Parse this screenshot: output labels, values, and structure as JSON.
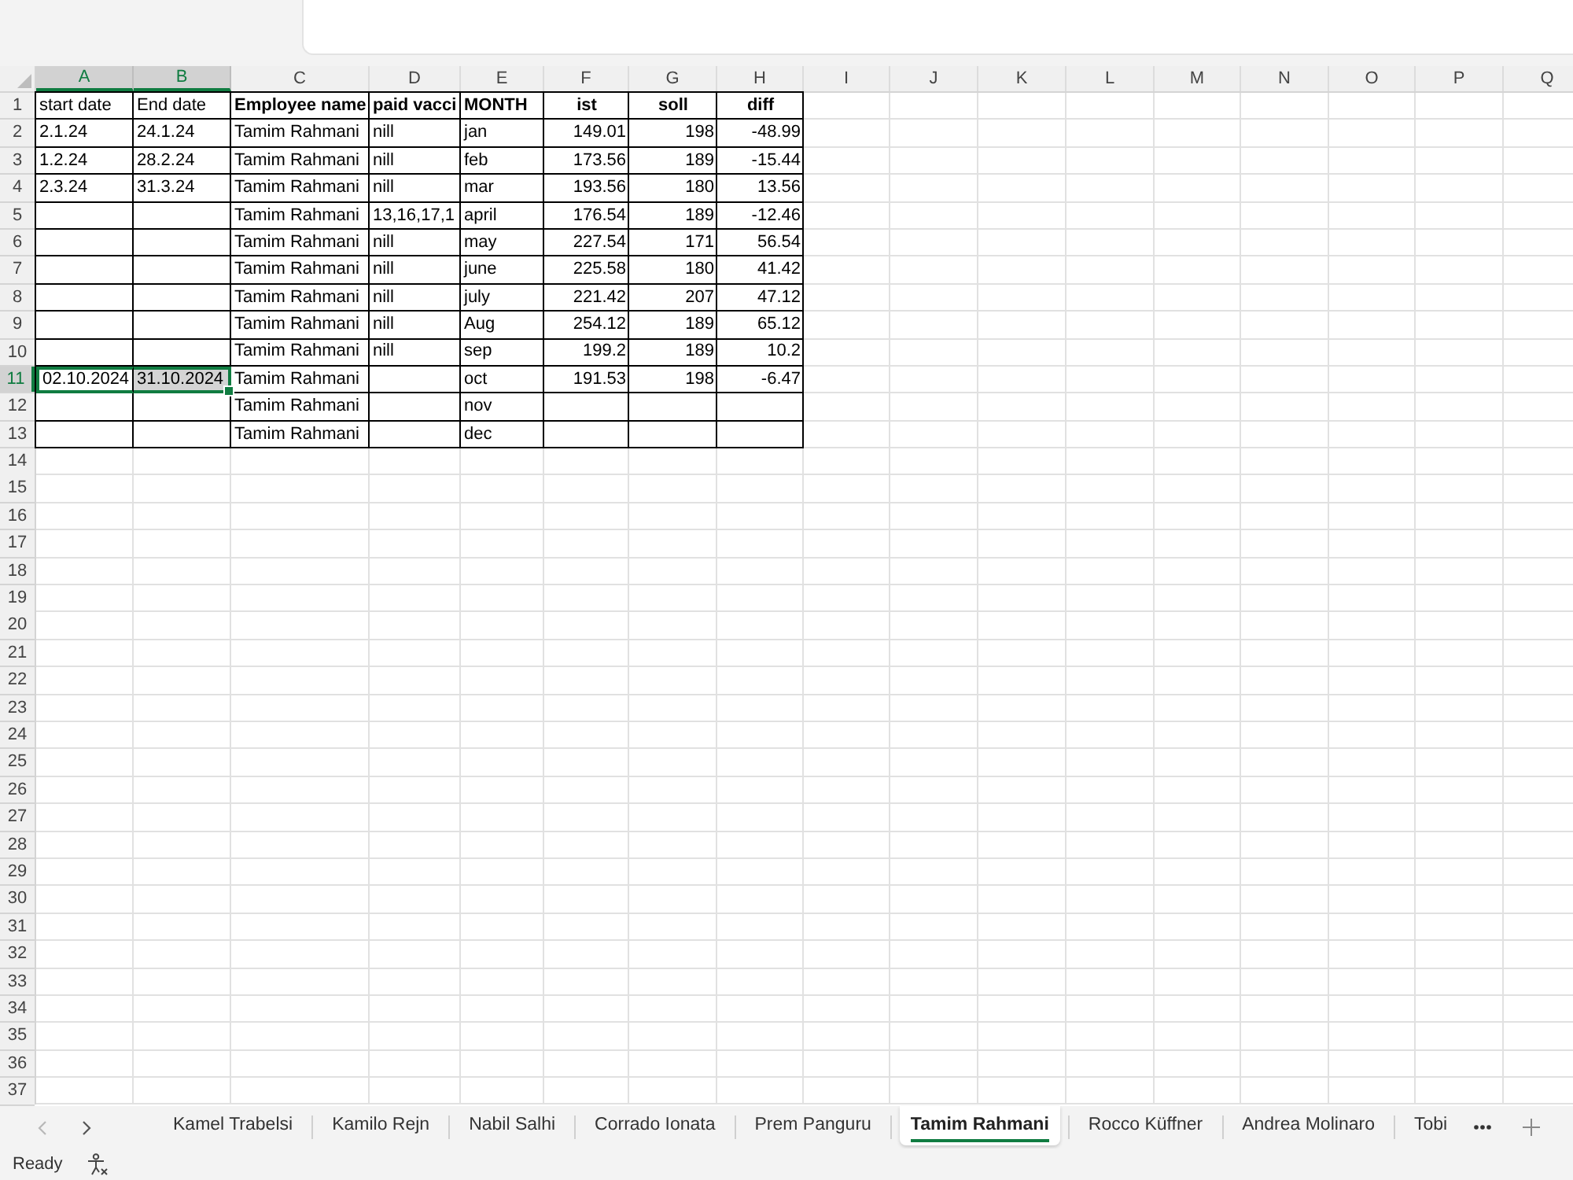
{
  "sheet": {
    "columns": [
      {
        "label": "A",
        "selected": true
      },
      {
        "label": "B",
        "selected": true
      },
      {
        "label": "C",
        "selected": false
      },
      {
        "label": "D",
        "selected": false
      },
      {
        "label": "E",
        "selected": false
      },
      {
        "label": "F",
        "selected": false
      },
      {
        "label": "G",
        "selected": false
      },
      {
        "label": "H",
        "selected": false
      },
      {
        "label": "I",
        "selected": false
      },
      {
        "label": "J",
        "selected": false
      },
      {
        "label": "K",
        "selected": false
      },
      {
        "label": "L",
        "selected": false
      },
      {
        "label": "M",
        "selected": false
      },
      {
        "label": "N",
        "selected": false
      },
      {
        "label": "O",
        "selected": false
      },
      {
        "label": "P",
        "selected": false
      },
      {
        "label": "Q",
        "selected": false
      }
    ],
    "rows": [
      {
        "label": "1",
        "selected": false,
        "cells": [
          {
            "text": "start date",
            "kind": "text",
            "selected": false,
            "active": false
          },
          {
            "text": "End date",
            "kind": "text",
            "selected": false,
            "active": false
          },
          {
            "text": "Employee name",
            "kind": "heading",
            "selected": false,
            "active": false
          },
          {
            "text": "paid vacci",
            "kind": "heading",
            "selected": false,
            "active": false
          },
          {
            "text": "MONTH",
            "kind": "heading",
            "selected": false,
            "active": false
          },
          {
            "text": "ist",
            "kind": "column_heading",
            "selected": false,
            "active": false
          },
          {
            "text": "soll",
            "kind": "column_heading",
            "selected": false,
            "active": false
          },
          {
            "text": "diff",
            "kind": "column_heading",
            "selected": false,
            "active": false
          }
        ]
      },
      {
        "label": "2",
        "selected": false,
        "cells": [
          {
            "text": "2.1.24",
            "kind": "text",
            "selected": false,
            "active": false
          },
          {
            "text": "24.1.24",
            "kind": "text",
            "selected": false,
            "active": false
          },
          {
            "text": "Tamim Rahmani",
            "kind": "text",
            "selected": false,
            "active": false
          },
          {
            "text": "nill",
            "kind": "text",
            "selected": false,
            "active": false
          },
          {
            "text": "jan",
            "kind": "text",
            "selected": false,
            "active": false
          },
          {
            "text": "149.01",
            "kind": "number",
            "selected": false,
            "active": false
          },
          {
            "text": "198",
            "kind": "number",
            "selected": false,
            "active": false
          },
          {
            "text": "-48.99",
            "kind": "number",
            "selected": false,
            "active": false
          }
        ]
      },
      {
        "label": "3",
        "selected": false,
        "cells": [
          {
            "text": "1.2.24",
            "kind": "text",
            "selected": false,
            "active": false
          },
          {
            "text": "28.2.24",
            "kind": "text",
            "selected": false,
            "active": false
          },
          {
            "text": "Tamim Rahmani",
            "kind": "text",
            "selected": false,
            "active": false
          },
          {
            "text": "nill",
            "kind": "text",
            "selected": false,
            "active": false
          },
          {
            "text": "feb",
            "kind": "text",
            "selected": false,
            "active": false
          },
          {
            "text": "173.56",
            "kind": "number",
            "selected": false,
            "active": false
          },
          {
            "text": "189",
            "kind": "number",
            "selected": false,
            "active": false
          },
          {
            "text": "-15.44",
            "kind": "number",
            "selected": false,
            "active": false
          }
        ]
      },
      {
        "label": "4",
        "selected": false,
        "cells": [
          {
            "text": "2.3.24",
            "kind": "text",
            "selected": false,
            "active": false
          },
          {
            "text": "31.3.24",
            "kind": "text",
            "selected": false,
            "active": false
          },
          {
            "text": "Tamim Rahmani",
            "kind": "text",
            "selected": false,
            "active": false
          },
          {
            "text": "nill",
            "kind": "text",
            "selected": false,
            "active": false
          },
          {
            "text": "mar",
            "kind": "text",
            "selected": false,
            "active": false
          },
          {
            "text": "193.56",
            "kind": "number",
            "selected": false,
            "active": false
          },
          {
            "text": "180",
            "kind": "number",
            "selected": false,
            "active": false
          },
          {
            "text": "13.56",
            "kind": "number",
            "selected": false,
            "active": false
          }
        ]
      },
      {
        "label": "5",
        "selected": false,
        "cells": [
          {
            "selected": false,
            "active": false
          },
          {
            "selected": false,
            "active": false
          },
          {
            "text": "Tamim Rahmani",
            "kind": "text",
            "selected": false,
            "active": false
          },
          {
            "text": "13,16,17,1",
            "kind": "text",
            "selected": false,
            "active": false
          },
          {
            "text": "april",
            "kind": "text",
            "selected": false,
            "active": false
          },
          {
            "text": "176.54",
            "kind": "number",
            "selected": false,
            "active": false
          },
          {
            "text": "189",
            "kind": "number",
            "selected": false,
            "active": false
          },
          {
            "text": "-12.46",
            "kind": "number",
            "selected": false,
            "active": false
          }
        ]
      },
      {
        "label": "6",
        "selected": false,
        "cells": [
          {
            "selected": false,
            "active": false
          },
          {
            "selected": false,
            "active": false
          },
          {
            "text": "Tamim Rahmani",
            "kind": "text",
            "selected": false,
            "active": false
          },
          {
            "text": "nill",
            "kind": "text",
            "selected": false,
            "active": false
          },
          {
            "text": "may",
            "kind": "text",
            "selected": false,
            "active": false
          },
          {
            "text": "227.54",
            "kind": "number",
            "selected": false,
            "active": false
          },
          {
            "text": "171",
            "kind": "number",
            "selected": false,
            "active": false
          },
          {
            "text": "56.54",
            "kind": "number",
            "selected": false,
            "active": false
          }
        ]
      },
      {
        "label": "7",
        "selected": false,
        "cells": [
          {
            "selected": false,
            "active": false
          },
          {
            "selected": false,
            "active": false
          },
          {
            "text": "Tamim Rahmani",
            "kind": "text",
            "selected": false,
            "active": false
          },
          {
            "text": "nill",
            "kind": "text",
            "selected": false,
            "active": false
          },
          {
            "text": "june",
            "kind": "text",
            "selected": false,
            "active": false
          },
          {
            "text": "225.58",
            "kind": "number",
            "selected": false,
            "active": false
          },
          {
            "text": "180",
            "kind": "number",
            "selected": false,
            "active": false
          },
          {
            "text": "41.42",
            "kind": "number",
            "selected": false,
            "active": false
          }
        ]
      },
      {
        "label": "8",
        "selected": false,
        "cells": [
          {
            "selected": false,
            "active": false
          },
          {
            "selected": false,
            "active": false
          },
          {
            "text": "Tamim Rahmani",
            "kind": "text",
            "selected": false,
            "active": false
          },
          {
            "text": "nill",
            "kind": "text",
            "selected": false,
            "active": false
          },
          {
            "text": "july",
            "kind": "text",
            "selected": false,
            "active": false
          },
          {
            "text": "221.42",
            "kind": "number",
            "selected": false,
            "active": false
          },
          {
            "text": "207",
            "kind": "number",
            "selected": false,
            "active": false
          },
          {
            "text": "47.12",
            "kind": "number",
            "selected": false,
            "active": false
          }
        ]
      },
      {
        "label": "9",
        "selected": false,
        "cells": [
          {
            "selected": false,
            "active": false
          },
          {
            "selected": false,
            "active": false
          },
          {
            "text": "Tamim Rahmani",
            "kind": "text",
            "selected": false,
            "active": false
          },
          {
            "text": "nill",
            "kind": "text",
            "selected": false,
            "active": false
          },
          {
            "text": "Aug",
            "kind": "text",
            "selected": false,
            "active": false
          },
          {
            "text": "254.12",
            "kind": "number",
            "selected": false,
            "active": false
          },
          {
            "text": "189",
            "kind": "number",
            "selected": false,
            "active": false
          },
          {
            "text": "65.12",
            "kind": "number",
            "selected": false,
            "active": false
          }
        ]
      },
      {
        "label": "10",
        "selected": false,
        "cells": [
          {
            "selected": false,
            "active": false
          },
          {
            "selected": false,
            "active": false
          },
          {
            "text": "Tamim Rahmani",
            "kind": "text",
            "selected": false,
            "active": false
          },
          {
            "text": "nill",
            "kind": "text",
            "selected": false,
            "active": false
          },
          {
            "text": "sep",
            "kind": "text",
            "selected": false,
            "active": false
          },
          {
            "text": "199.2",
            "kind": "number",
            "selected": false,
            "active": false
          },
          {
            "text": "189",
            "kind": "number",
            "selected": false,
            "active": false
          },
          {
            "text": "10.2",
            "kind": "number",
            "selected": false,
            "active": false
          }
        ]
      },
      {
        "label": "11",
        "selected": true,
        "cells": [
          {
            "text": "02.10.2024",
            "kind": "text",
            "selected": true,
            "active": true
          },
          {
            "text": "31.10.2024",
            "kind": "text",
            "selected": true,
            "active": false
          },
          {
            "text": "Tamim Rahmani",
            "kind": "text",
            "selected": false,
            "active": false
          },
          {
            "selected": false,
            "active": false
          },
          {
            "text": "oct",
            "kind": "text",
            "selected": false,
            "active": false
          },
          {
            "text": "191.53",
            "kind": "number",
            "selected": false,
            "active": false
          },
          {
            "text": "198",
            "kind": "number",
            "selected": false,
            "active": false
          },
          {
            "text": "-6.47",
            "kind": "number",
            "selected": false,
            "active": false
          }
        ]
      },
      {
        "label": "12",
        "selected": false,
        "cells": [
          {
            "selected": false,
            "active": false
          },
          {
            "selected": false,
            "active": false
          },
          {
            "text": "Tamim Rahmani",
            "kind": "text",
            "selected": false,
            "active": false
          },
          {
            "selected": false,
            "active": false
          },
          {
            "text": "nov",
            "kind": "text",
            "selected": false,
            "active": false
          },
          {
            "selected": false,
            "active": false
          },
          {
            "selected": false,
            "active": false
          },
          {
            "selected": false,
            "active": false
          }
        ]
      },
      {
        "label": "13",
        "selected": false,
        "cells": [
          {
            "selected": false,
            "active": false
          },
          {
            "selected": false,
            "active": false
          },
          {
            "text": "Tamim Rahmani",
            "kind": "text",
            "selected": false,
            "active": false
          },
          {
            "selected": false,
            "active": false
          },
          {
            "text": "dec",
            "kind": "text",
            "selected": false,
            "active": false
          },
          {
            "selected": false,
            "active": false
          },
          {
            "selected": false,
            "active": false
          },
          {
            "selected": false,
            "active": false
          }
        ]
      },
      {
        "label": "14",
        "selected": false
      },
      {
        "label": "15",
        "selected": false
      },
      {
        "label": "16",
        "selected": false
      },
      {
        "label": "17",
        "selected": false
      },
      {
        "label": "18",
        "selected": false
      },
      {
        "label": "19",
        "selected": false
      },
      {
        "label": "20",
        "selected": false
      },
      {
        "label": "21",
        "selected": false
      },
      {
        "label": "22",
        "selected": false
      },
      {
        "label": "23",
        "selected": false
      },
      {
        "label": "24",
        "selected": false
      },
      {
        "label": "25",
        "selected": false
      },
      {
        "label": "26",
        "selected": false
      },
      {
        "label": "27",
        "selected": false
      },
      {
        "label": "28",
        "selected": false
      },
      {
        "label": "29",
        "selected": false
      },
      {
        "label": "30",
        "selected": false
      },
      {
        "label": "31",
        "selected": false
      },
      {
        "label": "32",
        "selected": false
      },
      {
        "label": "33",
        "selected": false
      },
      {
        "label": "34",
        "selected": false
      },
      {
        "label": "35",
        "selected": false
      },
      {
        "label": "36",
        "selected": false
      },
      {
        "label": "37",
        "selected": false
      }
    ]
  },
  "sheet_tabs": {
    "scroll_buttons": [
      {
        "kind": "previous",
        "disabled": true
      },
      {
        "kind": "next",
        "disabled": false
      }
    ],
    "tabs": [
      {
        "label": "Kamel Trabelsi",
        "selected": false
      },
      {
        "label": "Kamilo Rejn",
        "selected": false
      },
      {
        "label": "Nabil Salhi",
        "selected": false
      },
      {
        "label": "Corrado Ionata",
        "selected": false
      },
      {
        "label": "Prem Panguru",
        "selected": false
      },
      {
        "label": "Tamim Rahmani",
        "selected": true
      },
      {
        "label": "Rocco Küffner",
        "selected": false
      },
      {
        "label": "Andrea Molinaro",
        "selected": false
      },
      {
        "label": "Tobi",
        "selected": false
      }
    ]
  },
  "status_bar": {
    "status": "Ready"
  }
}
